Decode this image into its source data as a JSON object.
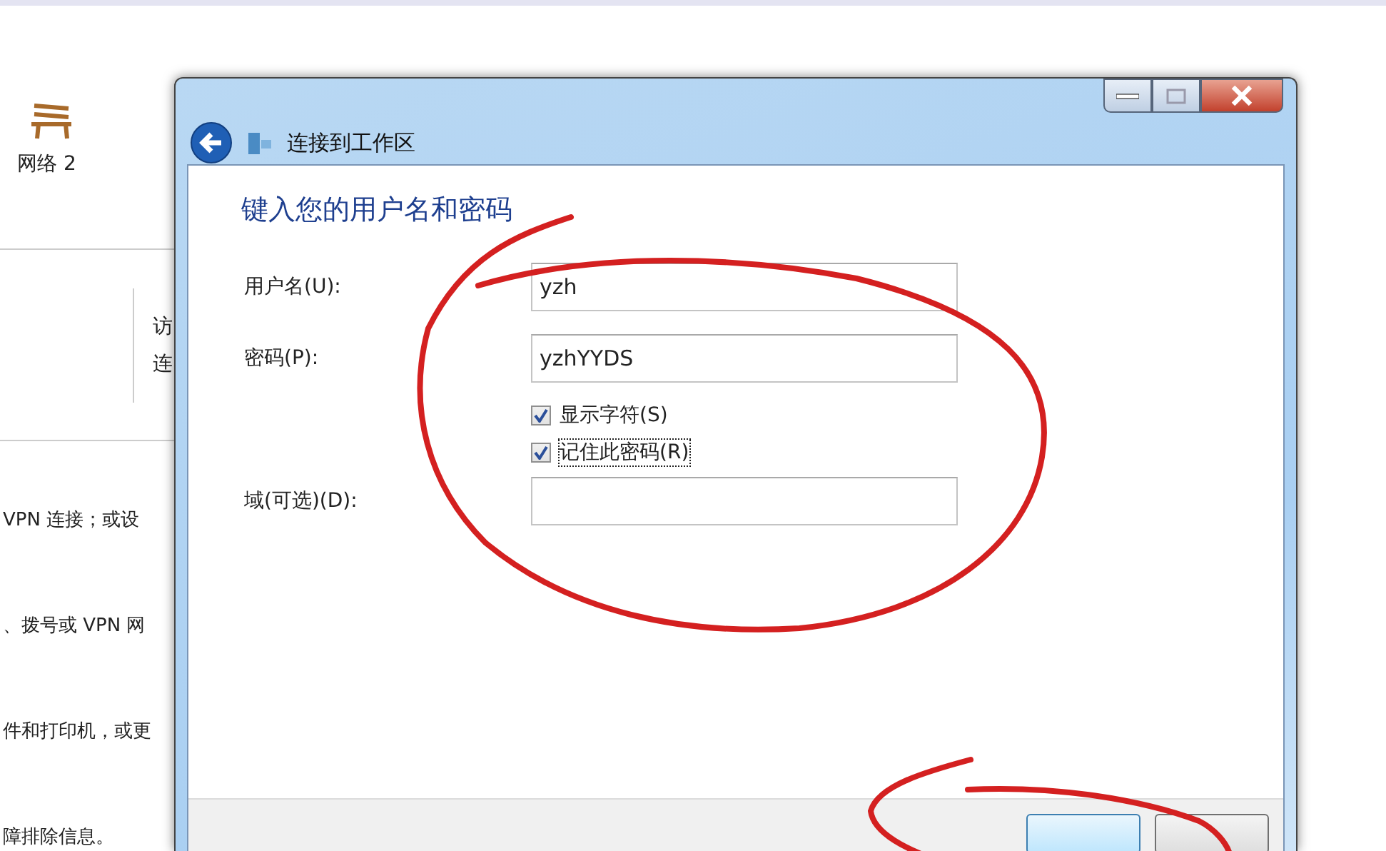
{
  "background": {
    "network_label": "网络 2",
    "side_texts": [
      "访",
      "连"
    ],
    "lines": [
      "VPN 连接；或设",
      "、拨号或 VPN 网",
      "件和打印机，或更",
      "障排除信息。"
    ]
  },
  "dialog": {
    "title": "连接到工作区",
    "heading": "键入您的用户名和密码",
    "fields": [
      {
        "label": "用户名(U):",
        "value": "yzh"
      },
      {
        "label": "密码(P):",
        "value": "yzhYYDS"
      }
    ],
    "checkboxes": [
      {
        "label": "显示字符(S)",
        "checked": true,
        "focused": false
      },
      {
        "label": "记住此密码(R)",
        "checked": true,
        "focused": true
      }
    ],
    "domain": {
      "label": "域(可选)(D):"
    },
    "footer_buttons": [
      {
        "default": true
      },
      {
        "default": false
      }
    ]
  }
}
